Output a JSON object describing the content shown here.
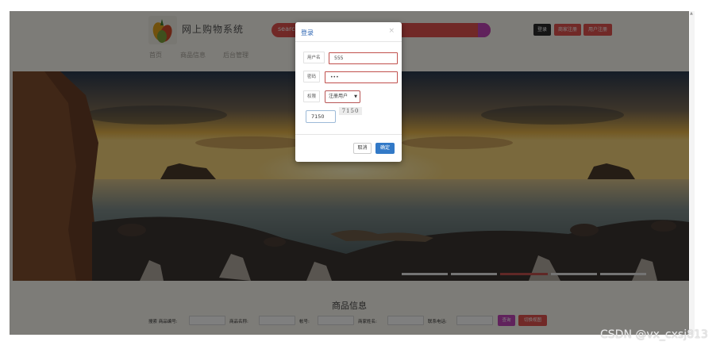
{
  "header": {
    "site_title": "网上购物系统",
    "search_placeholder": "search",
    "login_label": "登录",
    "merchant_register_label": "商家注册",
    "user_register_label": "用户注册"
  },
  "nav": {
    "items": [
      {
        "label": "首页"
      },
      {
        "label": "商品信息"
      },
      {
        "label": "后台管理"
      }
    ]
  },
  "banner": {
    "slide_indicators": 5,
    "active_slide": 3
  },
  "products_section": {
    "title": "商品信息",
    "filters": [
      {
        "label": "搜索 商品编号:"
      },
      {
        "label": "商品名称:"
      },
      {
        "label": "帐号:"
      },
      {
        "label": "商家姓名:"
      },
      {
        "label": "联系电话:"
      }
    ],
    "search_button": "查询",
    "reset_button": "切换视图"
  },
  "login_modal": {
    "title": "登录",
    "close_icon": "close-icon",
    "username_label": "用户名",
    "username_value": "555",
    "password_label": "密码",
    "password_value": "•••",
    "role_label": "权限",
    "role_value": "注册用户",
    "captcha_text": "7150",
    "captcha_input_value": "7150",
    "cancel_label": "取消",
    "confirm_label": "确定"
  },
  "colors": {
    "accent_red": "#e2534f",
    "accent_magenta": "#c044b8",
    "primary_blue": "#3279c7",
    "login_button": "#2a2a2a"
  },
  "watermark": "CSDN @vx_cxsj813"
}
